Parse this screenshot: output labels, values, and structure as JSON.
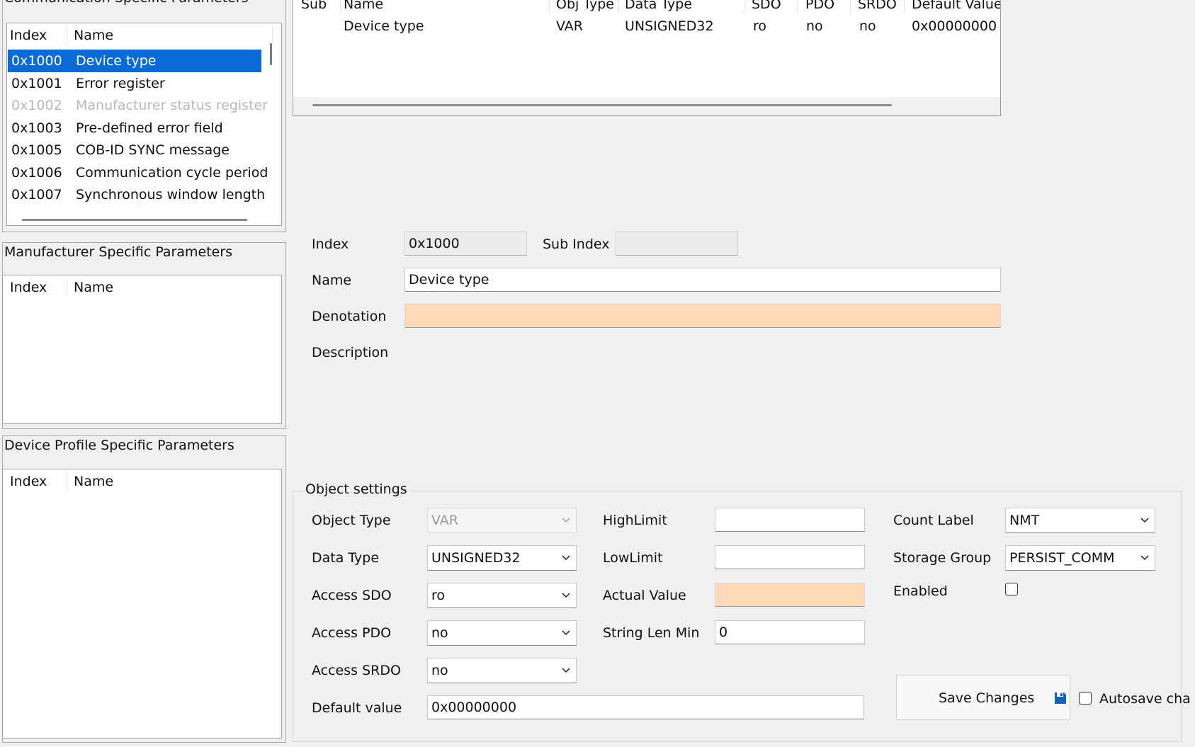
{
  "comm_panel": {
    "title": "Communication Specific Parameters",
    "columns": {
      "index": "Index",
      "name": "Name"
    },
    "rows": [
      {
        "index": "0x1000",
        "name": "Device type",
        "selected": true,
        "disabled": false
      },
      {
        "index": "0x1001",
        "name": "Error register",
        "selected": false,
        "disabled": false
      },
      {
        "index": "0x1002",
        "name": "Manufacturer status register",
        "selected": false,
        "disabled": true
      },
      {
        "index": "0x1003",
        "name": "Pre-defined error field",
        "selected": false,
        "disabled": false
      },
      {
        "index": "0x1005",
        "name": "COB-ID SYNC message",
        "selected": false,
        "disabled": false
      },
      {
        "index": "0x1006",
        "name": "Communication cycle period",
        "selected": false,
        "disabled": false
      },
      {
        "index": "0x1007",
        "name": "Synchronous window length",
        "selected": false,
        "disabled": false
      }
    ]
  },
  "mfr_panel": {
    "title": "Manufacturer Specific Parameters",
    "columns": {
      "index": "Index",
      "name": "Name"
    }
  },
  "profile_panel": {
    "title": "Device Profile Specific Parameters",
    "columns": {
      "index": "Index",
      "name": "Name"
    }
  },
  "sub_table": {
    "headers": {
      "sub": "Sub",
      "name": "Name",
      "obj_type": "Obj Type",
      "data_type": "Data Type",
      "sdo": "SDO",
      "pdo": "PDO",
      "srdo": "SRDO",
      "default": "Default Value"
    },
    "row": {
      "sub": "",
      "name": "Device type",
      "obj_type": "VAR",
      "data_type": "UNSIGNED32",
      "sdo": "ro",
      "pdo": "no",
      "srdo": "no",
      "default": "0x00000000"
    }
  },
  "details": {
    "index_label": "Index",
    "index_value": "0x1000",
    "subindex_label": "Sub Index",
    "subindex_value": "",
    "name_label": "Name",
    "name_value": "Device type",
    "denotation_label": "Denotation",
    "denotation_value": "",
    "description_label": "Description"
  },
  "object_settings": {
    "title": "Object settings",
    "object_type": {
      "label": "Object Type",
      "value": "VAR"
    },
    "data_type": {
      "label": "Data Type",
      "value": "UNSIGNED32"
    },
    "access_sdo": {
      "label": "Access SDO",
      "value": "ro"
    },
    "access_pdo": {
      "label": "Access PDO",
      "value": "no"
    },
    "access_srdo": {
      "label": "Access SRDO",
      "value": "no"
    },
    "default_value": {
      "label": "Default value",
      "value": "0x00000000"
    },
    "high_limit": {
      "label": "HighLimit",
      "value": ""
    },
    "low_limit": {
      "label": "LowLimit",
      "value": ""
    },
    "actual_value": {
      "label": "Actual Value",
      "value": ""
    },
    "string_len_min": {
      "label": "String Len Min",
      "value": "0"
    },
    "count_label": {
      "label": "Count Label",
      "value": "NMT"
    },
    "storage_group": {
      "label": "Storage Group",
      "value": "PERSIST_COMM"
    },
    "enabled": {
      "label": "Enabled",
      "checked": false
    },
    "save_button": "Save Changes",
    "autosave": {
      "label": "Autosave cha",
      "checked": false
    }
  },
  "colors": {
    "selection": "#0a6ad6",
    "warning_fill": "#fdd9b8",
    "save_icon": "#1565c0"
  },
  "icons": {
    "save": "floppy-disk-icon",
    "dropdown": "chevron-down-icon"
  }
}
